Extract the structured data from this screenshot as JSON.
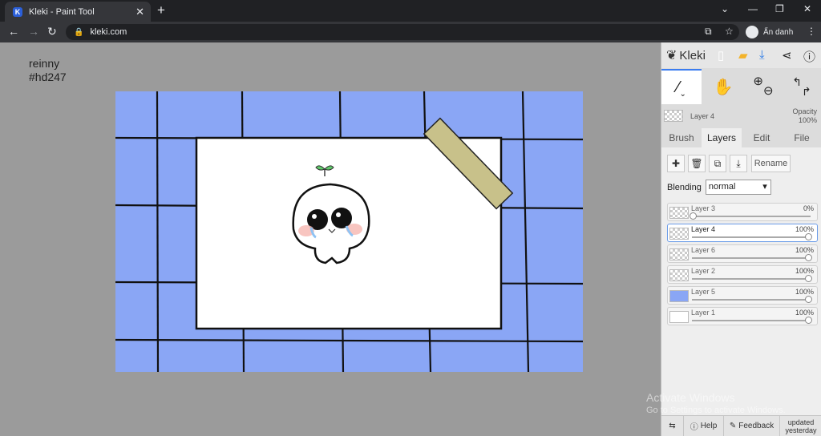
{
  "browser": {
    "tab_title": "Kleki - Paint Tool",
    "favicon_letter": "K",
    "url": "kleki.com",
    "profile_label": "Ẩn danh"
  },
  "canvas_note": {
    "line1": "reinny",
    "line2": "#hd247"
  },
  "app": {
    "name": "Kleki",
    "current_layer": "Layer 4",
    "opacity_label": "Opacity",
    "opacity_value": "100%",
    "tabs": [
      {
        "label": "Brush"
      },
      {
        "label": "Layers"
      },
      {
        "label": "Edit"
      },
      {
        "label": "File"
      }
    ],
    "rename_label": "Rename",
    "blending_label": "Blending",
    "blending_value": "normal",
    "layers": [
      {
        "name": "Layer 3",
        "opacity": "0%",
        "level": 0
      },
      {
        "name": "Layer 4",
        "opacity": "100%",
        "level": 1
      },
      {
        "name": "Layer 6",
        "opacity": "100%",
        "level": 1
      },
      {
        "name": "Layer 2",
        "opacity": "100%",
        "level": 1
      },
      {
        "name": "Layer 5",
        "opacity": "100%",
        "level": 1
      },
      {
        "name": "Layer 1",
        "opacity": "100%",
        "level": 1
      }
    ],
    "footer": {
      "help_label": "Help",
      "feedback_label": "Feedback",
      "updated_line1": "updated",
      "updated_line2": "yesterday"
    }
  },
  "watermark": {
    "line1": "Activate Windows",
    "line2": "Go to Settings to activate Windows."
  },
  "colors": {
    "grid_blue": "#8aa6f5",
    "tape": "#c8c18a",
    "accent": "#3c7df0"
  }
}
